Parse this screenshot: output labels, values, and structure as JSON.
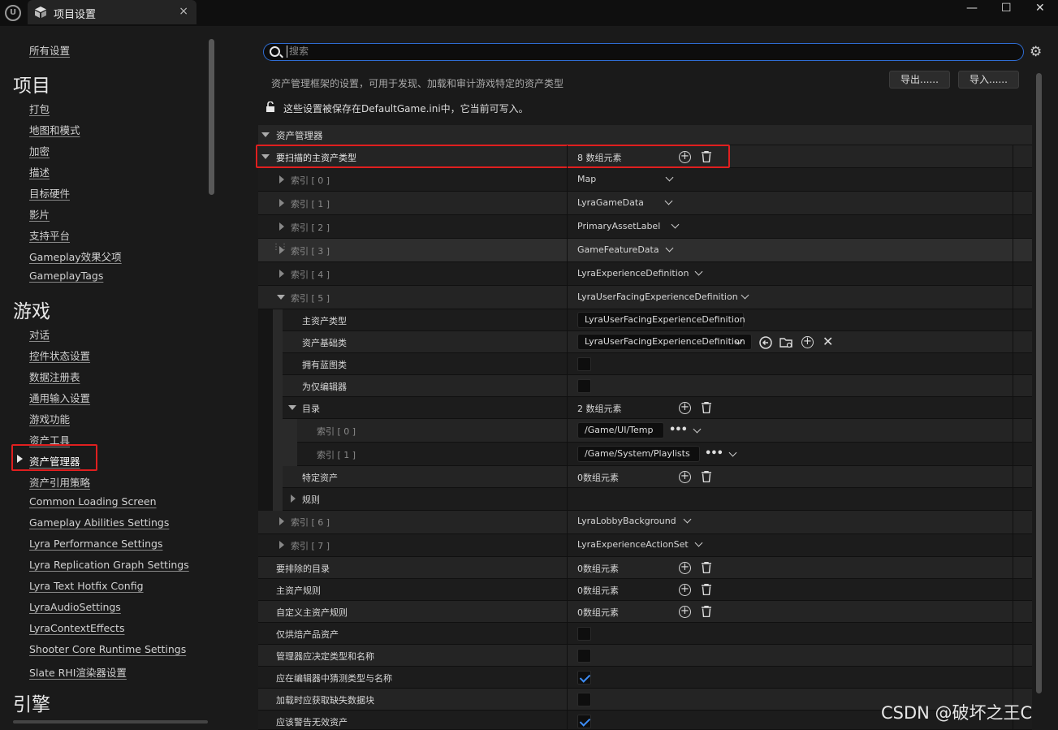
{
  "window": {
    "tab_title": "项目设置",
    "close": "×",
    "minimize": "—",
    "maximize": "☐",
    "win_close": "✕"
  },
  "sidebar": {
    "all_settings": "所有设置",
    "section_project": "项目",
    "project_items": [
      "打包",
      "地图和模式",
      "加密",
      "描述",
      "目标硬件",
      "影片",
      "支持平台",
      "Gameplay效果父项",
      "GameplayTags"
    ],
    "section_game": "游戏",
    "game_items": [
      "对话",
      "控件状态设置",
      "数据注册表",
      "通用输入设置",
      "游戏功能",
      "资产工具",
      "资产管理器",
      "资产引用策略",
      "Common Loading Screen",
      "Gameplay Abilities Settings",
      "Lyra Performance Settings",
      "Lyra Replication Graph Settings",
      "Lyra Text Hotfix Config",
      "LyraAudioSettings",
      "LyraContextEffects",
      "Shooter Core Runtime Settings",
      "Slate RHI渲染器设置"
    ],
    "section_engine": "引擎",
    "selected": "资产管理器"
  },
  "search": {
    "placeholder": "搜索"
  },
  "header": {
    "description": "资产管理框架的设置，可用于发现、加载和审计游戏特定的资产类型",
    "export_label": "导出......",
    "import_label": "导入......",
    "save_note": "这些设置被保存在DefaultGame.ini中，它当前可写入。"
  },
  "category": "资产管理器",
  "primary": {
    "label": "要扫描的主资产类型",
    "count": "8 数组元素"
  },
  "indices": [
    {
      "label": "索引 [ 0 ]",
      "value": "Map"
    },
    {
      "label": "索引 [ 1 ]",
      "value": "LyraGameData"
    },
    {
      "label": "索引 [ 2 ]",
      "value": "PrimaryAssetLabel"
    },
    {
      "label": "索引 [ 3 ]",
      "value": "GameFeatureData"
    },
    {
      "label": "索引 [ 4 ]",
      "value": "LyraExperienceDefinition"
    },
    {
      "label": "索引 [ 5 ]",
      "value": "LyraUserFacingExperienceDefinition"
    },
    {
      "label": "索引 [ 6 ]",
      "value": "LyraLobbyBackground"
    },
    {
      "label": "索引 [ 7 ]",
      "value": "LyraExperienceActionSet"
    }
  ],
  "expanded": {
    "primary_type_label": "主资产类型",
    "primary_type_value": "LyraUserFacingExperienceDefinition",
    "base_class_label": "资产基础类",
    "base_class_value": "LyraUserFacingExperienceDefinition",
    "has_bp_label": "拥有蓝图类",
    "editor_only_label": "为仅编辑器",
    "dirs_label": "目录",
    "dirs_count": "2 数组元素",
    "dir0_label": "索引 [ 0 ]",
    "dir0_value": "/Game/UI/Temp",
    "dir1_label": "索引 [ 1 ]",
    "dir1_value": "/Game/System/Playlists",
    "specific_label": "特定资产",
    "specific_count": "0数组元素",
    "rules_label": "规则"
  },
  "bottom_rows": [
    {
      "label": "要排除的目录",
      "value": "0数组元素"
    },
    {
      "label": "主资产规则",
      "value": "0数组元素"
    },
    {
      "label": "自定义主资产规则",
      "value": "0数组元素"
    },
    {
      "label": "仅烘焙产品资产"
    },
    {
      "label": "管理器应决定类型和名称"
    },
    {
      "label": "应在编辑器中猜测类型与名称"
    },
    {
      "label": "加载时应获取缺失数据块"
    },
    {
      "label": "应该警告无效资产"
    }
  ],
  "checks": {
    "cook_only": false,
    "decide_type": false,
    "guess_in_editor": true,
    "fetch_missing": false,
    "warn_invalid": true,
    "has_bp": false,
    "editor_only": false
  },
  "watermark": "CSDN @破坏之王C",
  "colors": {
    "highlight": "#e01f1f",
    "accent": "#2f6dd3",
    "check": "#3e8ef7"
  }
}
